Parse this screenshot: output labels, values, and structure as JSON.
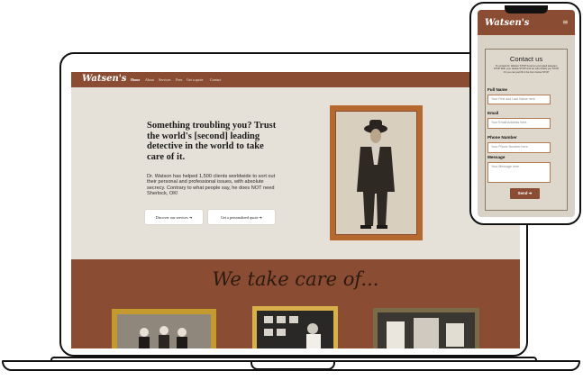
{
  "desktop": {
    "logo": "Watsen's",
    "nav": [
      "Home",
      "About",
      "Services",
      "Fees",
      "Get a quote",
      "Contact"
    ],
    "hero": {
      "title": "Something troubling you? Trust the world's [second] leading detective in the world to take care of it.",
      "text": "Dr. Watson has helped 1,500 clients worldwide to sort out their personal and professional issues, with absolute secrecy. Contrary to what people say, he does NOT need Sherlock, OK!",
      "btn_services": "Discover our services ➔",
      "btn_quote": "Get a personalized quote ➔"
    },
    "section_title": "We take care of..."
  },
  "phone": {
    "logo": "Watsen's",
    "menu_icon": "≡",
    "contact_title": "Contact us",
    "contact_intro": "To contact Dr. Watson STOP Send an encrypted telegram STOP With your details STOP And we will contact you STOP Or you can just fill in the form below STOP",
    "fields": [
      {
        "label": "Full Name",
        "placeholder": "Your First and Last Name here."
      },
      {
        "label": "Email",
        "placeholder": "Your Email Address here."
      },
      {
        "label": "Phone Number",
        "placeholder": "Your Phone Number here."
      },
      {
        "label": "Message",
        "placeholder": "Your Message here."
      }
    ],
    "send": "Send ➔"
  },
  "colors": {
    "brand_brown": "#8a4c32",
    "background": "#e6e1d8",
    "frame_gold": "#b5692e"
  }
}
